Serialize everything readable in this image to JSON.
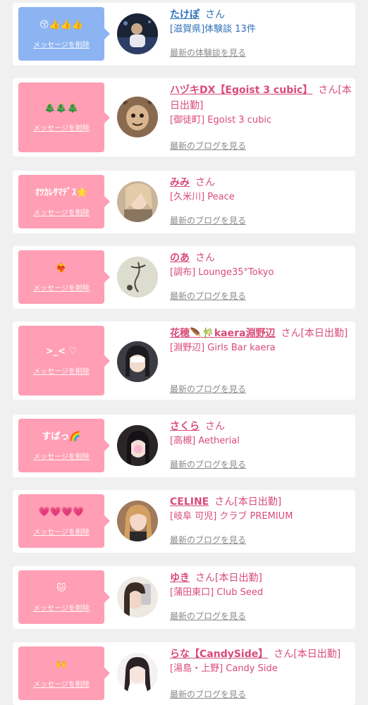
{
  "delete_label": "メッセージを削除",
  "san_label": "さん",
  "items": [
    {
      "message": "😚👍👍👍",
      "name": "たけぽ",
      "after_name": "",
      "detail": "[滋賀県]体験談 13件",
      "link": "最新の体験談を見る",
      "bubble_color": "#8cb4f2"
    },
    {
      "message": "🎄🎄🎄",
      "name": "ハヅキDX【Egoist 3 cubic】",
      "after_name": "[本日出勤]",
      "detail": "[御徒町] Egoist 3 cubic",
      "link": "最新のブログを見る",
      "bubble_color": "#ff9eb4"
    },
    {
      "message": "ｵﾂｶﾚｻﾏﾃﾞｽ🌟",
      "name": "みみ",
      "after_name": "",
      "detail": "[久米川] Peace",
      "link": "最新のブログを見る",
      "bubble_color": "#ff9eb4"
    },
    {
      "message": "❤️‍🔥",
      "name": "のあ",
      "after_name": "",
      "detail": "[調布] Lounge35°Tokyo",
      "link": "最新のブログを見る",
      "bubble_color": "#ff9eb4"
    },
    {
      "message": ">_< ♡",
      "name": "花穂🪶🎋kaera淵野辺",
      "after_name": "[本日出勤]",
      "detail": "[淵野辺] Girls Bar kaera",
      "link": "最新のブログを見る",
      "bubble_color": "#ff9eb4"
    },
    {
      "message": "すばっ🌈",
      "name": "さくら",
      "after_name": "",
      "detail": "[高槻] Aetherial",
      "link": "最新のブログを見る",
      "bubble_color": "#ff9eb4"
    },
    {
      "message": "💗💗💗💗",
      "name": "CELINE",
      "after_name": "[本日出勤]",
      "detail": "[岐阜 可児] クラブ PREMIUM",
      "link": "最新のブログを見る",
      "bubble_color": "#ff9eb4"
    },
    {
      "message": "🐱",
      "name": "ゆき",
      "after_name": "[本日出勤]",
      "detail": "[蒲田東口] Club Seed",
      "link": "最新のブログを見る",
      "bubble_color": "#ff9eb4"
    },
    {
      "message": "🙌",
      "name": "らな【CandySide】",
      "after_name": "[本日出勤]",
      "detail": "[湯島・上野] Candy Side",
      "link": "最新のブログを見る",
      "bubble_color": "#ff9eb4"
    }
  ]
}
